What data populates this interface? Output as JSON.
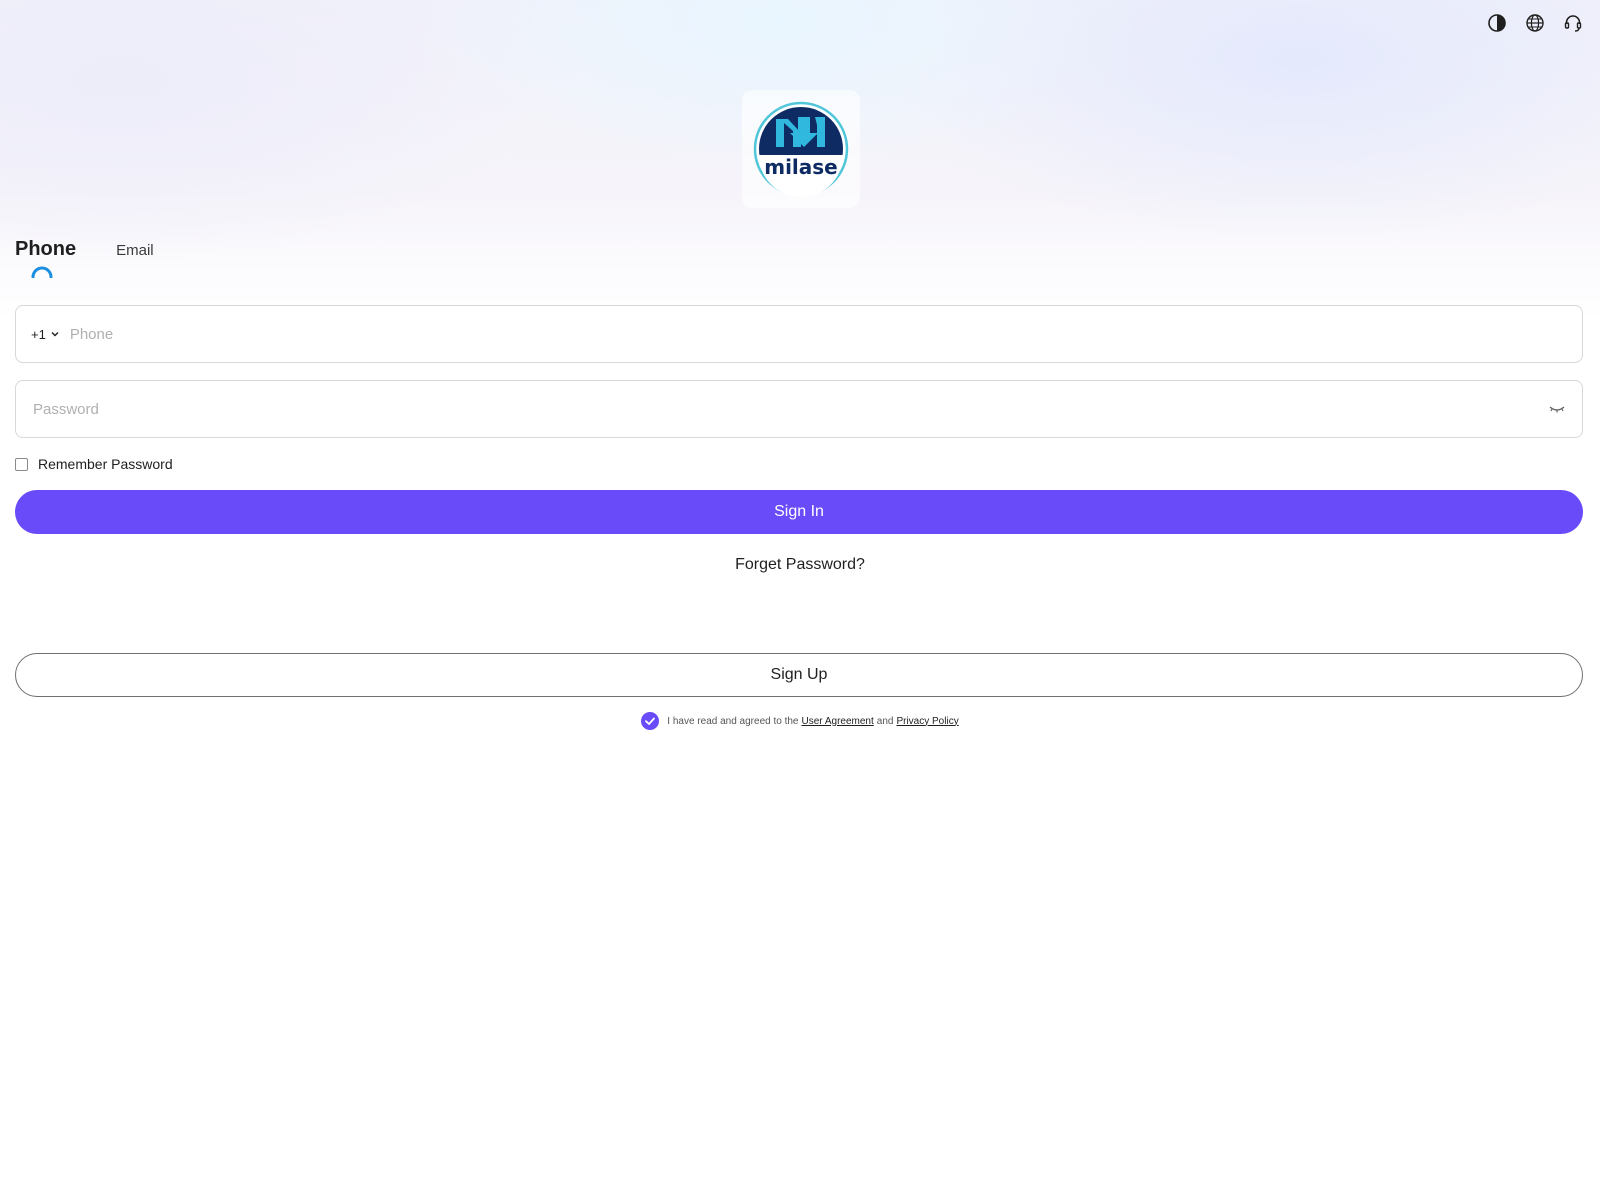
{
  "header": {
    "icons": [
      "contrast-icon",
      "globe-icon",
      "headset-icon"
    ]
  },
  "logo": {
    "text": "milase",
    "colors": {
      "outer": "#4fc6d9",
      "inner": "#0f2b63",
      "accent": "#31b8de"
    }
  },
  "tabs": [
    {
      "label": "Phone",
      "active": true
    },
    {
      "label": "Email",
      "active": false
    }
  ],
  "form": {
    "country_code": "+1",
    "phone_placeholder": "Phone",
    "password_placeholder": "Password",
    "remember_label": "Remember Password",
    "remember_checked": false
  },
  "actions": {
    "sign_in_label": "Sign In",
    "forget_label": "Forget Password?",
    "sign_up_label": "Sign Up"
  },
  "agreement": {
    "checked": true,
    "prefix": "I have read and agreed to the",
    "user_agreement": "User Agreement",
    "conjunction": "and",
    "privacy_policy": "Privacy Policy"
  },
  "colors": {
    "primary": "#6a4bfa",
    "tab_indicator": "#1a8ee0"
  }
}
